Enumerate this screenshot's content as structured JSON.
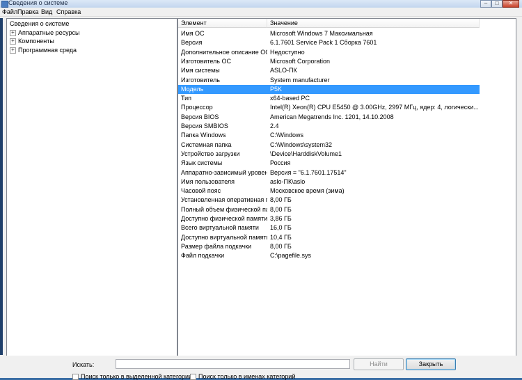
{
  "window": {
    "title": "Сведения о системе",
    "minimize": "–",
    "maximize": "□",
    "close": "✕"
  },
  "menu": [
    "Файл",
    "Правка",
    "Вид",
    "Справка"
  ],
  "tree": {
    "root": "Сведения о системе",
    "expander": "+",
    "children": [
      "Аппаратные ресурсы",
      "Компоненты",
      "Программная среда"
    ]
  },
  "table": {
    "headers": {
      "name": "Элемент",
      "value": "Значение"
    },
    "selected_index": 6,
    "rows": [
      {
        "name": "Имя ОС",
        "value": "Microsoft Windows 7 Максимальная"
      },
      {
        "name": "Версия",
        "value": "6.1.7601 Service Pack 1 Сборка 7601"
      },
      {
        "name": "Дополнительное описание ОС",
        "value": "Недоступно"
      },
      {
        "name": "Изготовитель ОС",
        "value": "Microsoft Corporation"
      },
      {
        "name": "Имя системы",
        "value": "ASLO-ПК"
      },
      {
        "name": "Изготовитель",
        "value": "System manufacturer"
      },
      {
        "name": "Модель",
        "value": "P5K"
      },
      {
        "name": "Тип",
        "value": "x64-based PC"
      },
      {
        "name": "Процессор",
        "value": "Intel(R) Xeon(R) CPU         E5450  @ 3.00GHz, 2997 МГц, ядер: 4, логически..."
      },
      {
        "name": "Версия BIOS",
        "value": "American Megatrends Inc. 1201, 14.10.2008"
      },
      {
        "name": "Версия SMBIOS",
        "value": "2.4"
      },
      {
        "name": "Папка Windows",
        "value": "C:\\Windows"
      },
      {
        "name": "Системная папка",
        "value": "C:\\Windows\\system32"
      },
      {
        "name": "Устройство загрузки",
        "value": "\\Device\\HarddiskVolume1"
      },
      {
        "name": "Язык системы",
        "value": "Россия"
      },
      {
        "name": "Аппаратно-зависимый уровен...",
        "value": "Версия = \"6.1.7601.17514\""
      },
      {
        "name": "Имя пользователя",
        "value": "aslo-ПК\\aslo"
      },
      {
        "name": "Часовой пояс",
        "value": "Московское время (зима)"
      },
      {
        "name": "Установленная оперативная п...",
        "value": "8,00 ГБ"
      },
      {
        "name": "Полный объем физической па...",
        "value": "8,00 ГБ"
      },
      {
        "name": "Доступно физической памяти",
        "value": "3,86 ГБ"
      },
      {
        "name": "Всего виртуальной памяти",
        "value": "16,0 ГБ"
      },
      {
        "name": "Доступно виртуальной памяти",
        "value": "10,4 ГБ"
      },
      {
        "name": "Размер файла подкачки",
        "value": "8,00 ГБ"
      },
      {
        "name": "Файл подкачки",
        "value": "C:\\pagefile.sys"
      }
    ]
  },
  "search": {
    "label": "Искать:",
    "value": "",
    "find_button": "Найти",
    "close_button": "Закрыть",
    "checkbox_selected_category": "Поиск только в выделенной категории",
    "checkbox_category_names": "Поиск только в именах категорий"
  },
  "colors": {
    "selection": "#3399ff",
    "window_bg": "#f0f0f0"
  }
}
